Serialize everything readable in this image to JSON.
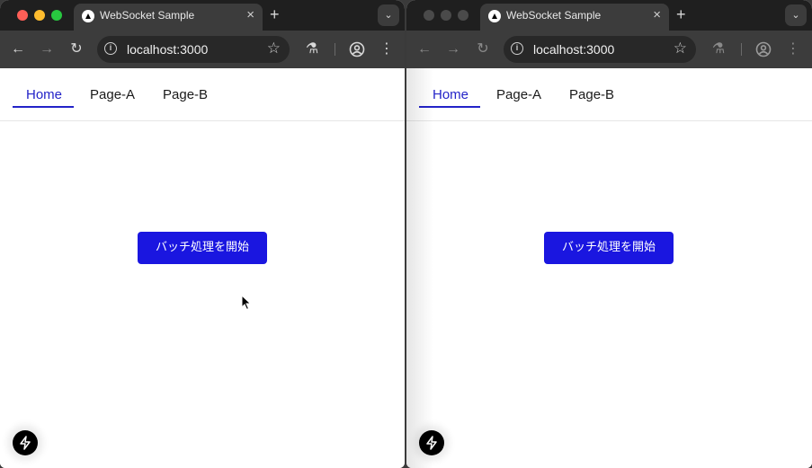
{
  "colors": {
    "tabstrip": "#1f1f1f",
    "toolbar": "#3c3c3c",
    "accent": "#2323c8",
    "button": "#1a16e0",
    "close": "#ff5f57",
    "minimize": "#febc2e",
    "zoom": "#28c840",
    "inactive_dot": "#4a4a4a"
  },
  "left_window": {
    "tab": {
      "title": "WebSocket Sample",
      "favicon": "nextjs-triangle-icon",
      "close": "×"
    },
    "new_tab": "+",
    "tablist": "⌄",
    "address": {
      "url": "localhost:3000"
    },
    "nav": {
      "home": "Home",
      "page_a": "Page-A",
      "page_b": "Page-B"
    },
    "button_label": "バッチ処理を開始"
  },
  "right_window": {
    "tab": {
      "title": "WebSocket Sample",
      "favicon": "nextjs-triangle-icon",
      "close": "×"
    },
    "new_tab": "+",
    "tablist": "⌄",
    "address": {
      "url": "localhost:3000"
    },
    "nav": {
      "home": "Home",
      "page_a": "Page-A",
      "page_b": "Page-B"
    },
    "button_label": "バッチ処理を開始"
  }
}
